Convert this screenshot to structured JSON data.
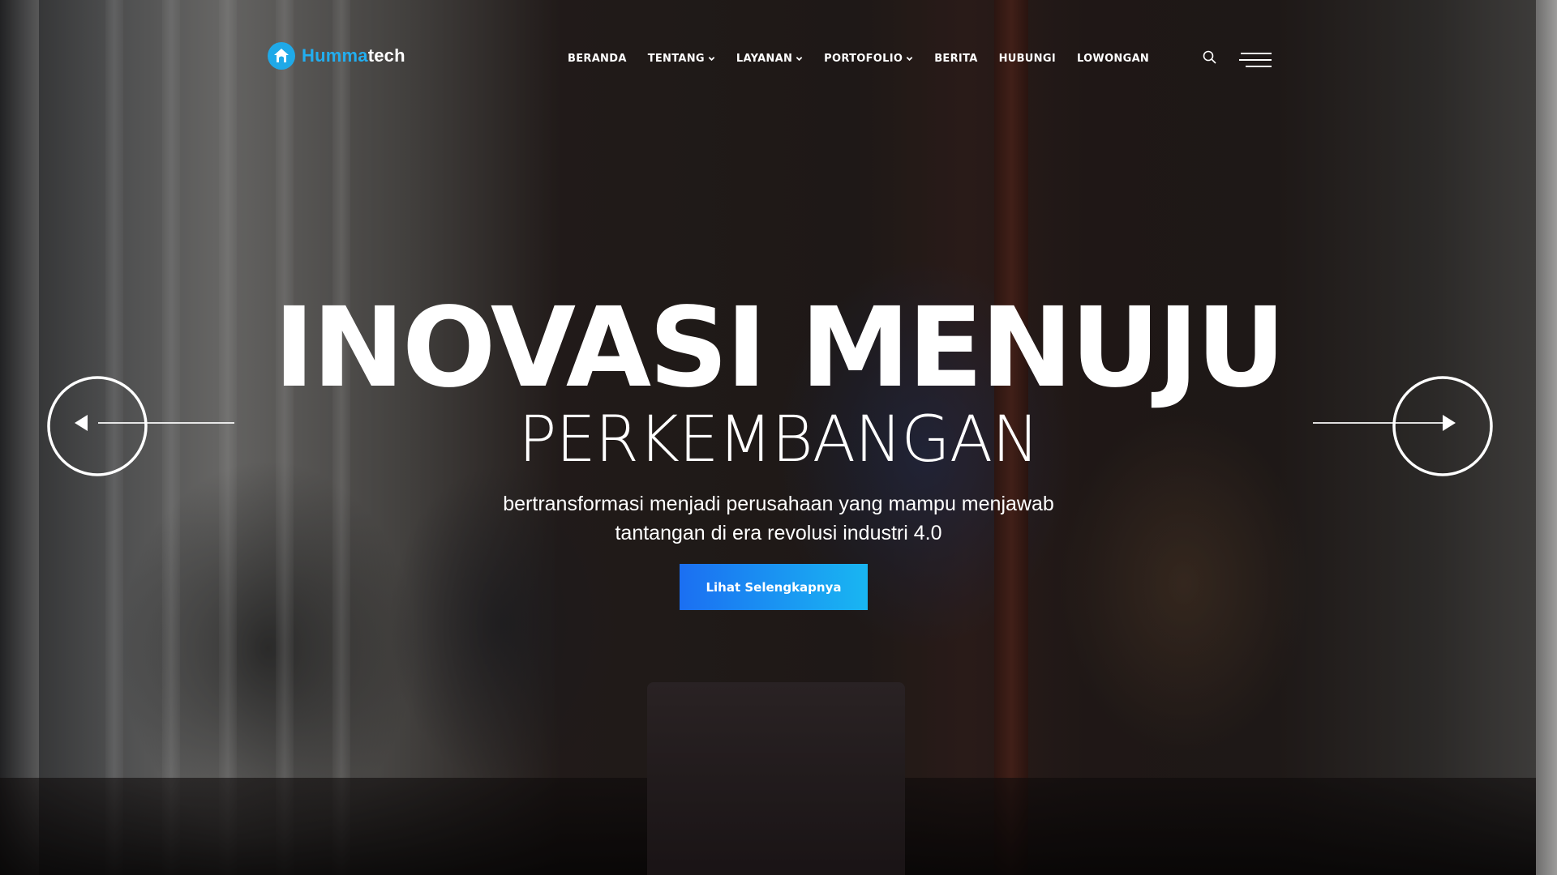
{
  "brand": {
    "name_accent": "Humma",
    "name_rest": "tech"
  },
  "nav": {
    "items": [
      {
        "label": "BERANDA",
        "dropdown": false
      },
      {
        "label": "TENTANG",
        "dropdown": true
      },
      {
        "label": "LAYANAN",
        "dropdown": true
      },
      {
        "label": "PORTOFOLIO",
        "dropdown": true
      },
      {
        "label": "BERITA",
        "dropdown": false
      },
      {
        "label": "HUBUNGI",
        "dropdown": false
      },
      {
        "label": "LOWONGAN",
        "dropdown": false
      }
    ]
  },
  "header_icons": {
    "search": "search-icon",
    "menu": "hamburger-menu-icon"
  },
  "hero": {
    "title": "INOVASI MENUJU",
    "subtitle": "PERKEMBANGAN",
    "description_line1": "bertransformasi menjadi perusahaan yang mampu menjawab",
    "description_line2": "tantangan di era revolusi industri 4.0",
    "cta_label": "Lihat Selengkapnya"
  },
  "slider": {
    "prev_icon": "arrow-left-icon",
    "next_icon": "arrow-right-icon"
  },
  "colors": {
    "accent": "#22aef0",
    "cta_start": "#1b6ff2",
    "cta_end": "#19b6f2"
  }
}
